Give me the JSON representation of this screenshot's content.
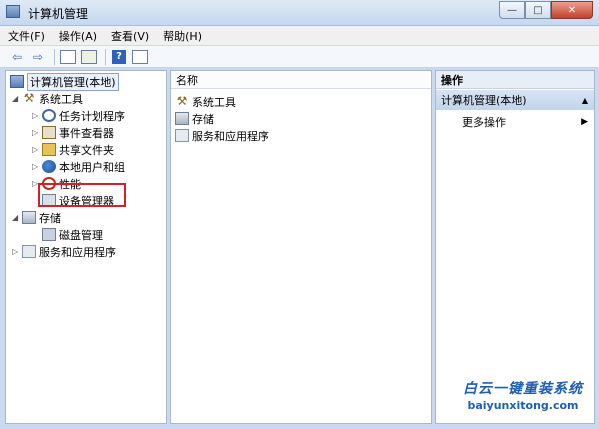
{
  "window": {
    "title": "计算机管理"
  },
  "window_buttons": {
    "minimize": "—",
    "maximize": "□",
    "close": "✕"
  },
  "menu": [
    "文件(F)",
    "操作(A)",
    "查看(V)",
    "帮助(H)"
  ],
  "toolbar": {
    "back": "⇦",
    "forward": "⇨",
    "help": "?"
  },
  "tree": {
    "root": "计算机管理(本地)",
    "system_tools": "系统工具",
    "task_scheduler": "任务计划程序",
    "event_viewer": "事件查看器",
    "shared_folders": "共享文件夹",
    "local_users": "本地用户和组",
    "performance": "性能",
    "device_manager": "设备管理器",
    "storage": "存储",
    "disk_management": "磁盘管理",
    "services_apps": "服务和应用程序"
  },
  "center": {
    "column_header": "名称",
    "items": [
      "系统工具",
      "存储",
      "服务和应用程序"
    ]
  },
  "actions": {
    "header": "操作",
    "selected": "计算机管理(本地)",
    "more": "更多操作"
  },
  "watermark": {
    "cn": "白云一键重装系统",
    "url": "baiyunxitong.com"
  },
  "colors": {
    "highlight_box": "#d51f2a",
    "watermark": "#1d5fb0"
  }
}
